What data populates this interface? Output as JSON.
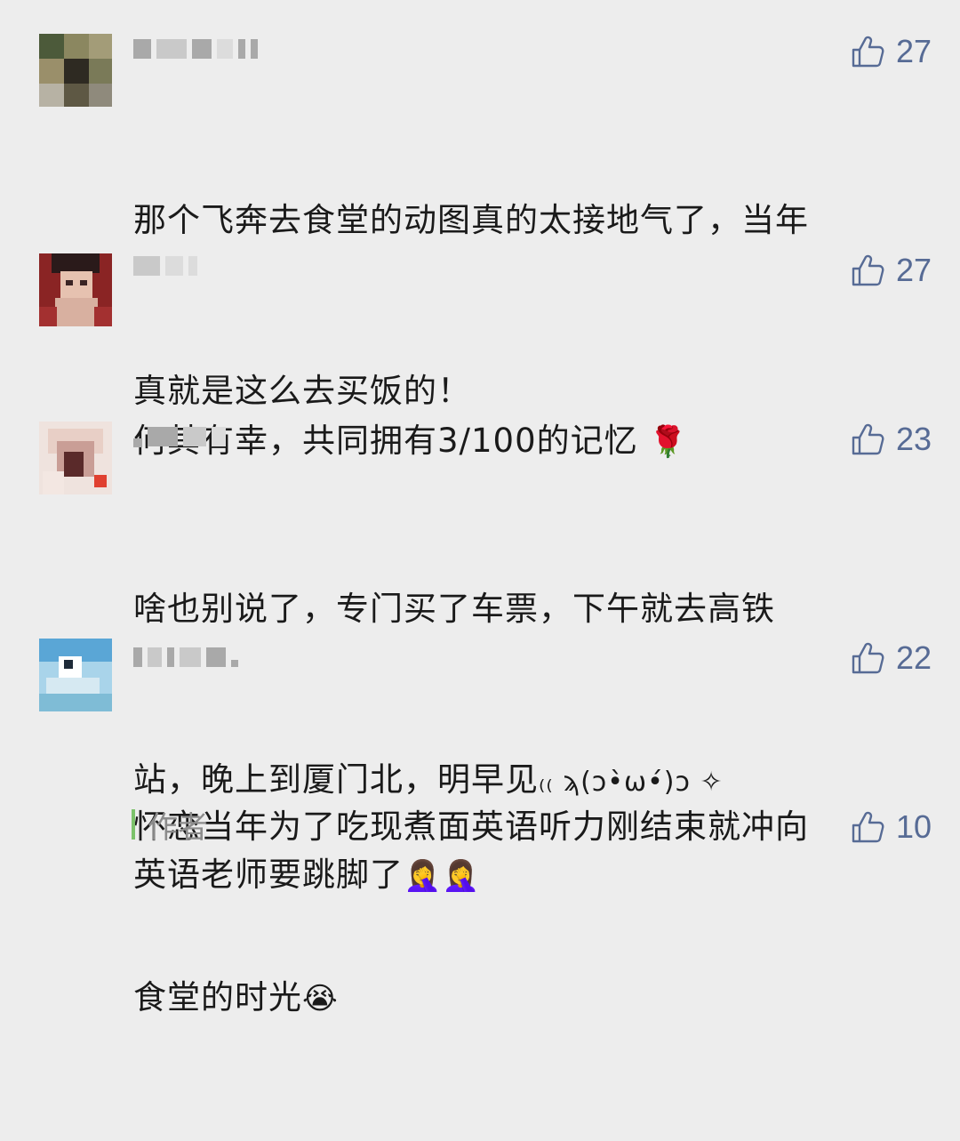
{
  "colors": {
    "background": "#ededed",
    "like_blue": "#576b95",
    "author_green": "#7cc26b"
  },
  "comments": [
    {
      "like_count": "27",
      "text_line1": "那个飞奔去食堂的动图真的太接地气了，当年",
      "text_line2": "真就是这么去买饭的！",
      "icon": "thumbs-up-icon"
    },
    {
      "like_count": "27",
      "text_line1": "何其有幸，共同拥有3/100的记忆",
      "emoji": "🌹",
      "icon": "thumbs-up-icon"
    },
    {
      "like_count": "23",
      "text_line1": "啥也别说了，专门买了车票，下午就去高铁",
      "text_line2": "站，晚上到厦门北，明早见",
      "kaomoji": "₍₍ ϡ(ↄ•̀ω•́)ↄ ✧",
      "icon": "thumbs-up-icon"
    },
    {
      "like_count": "22",
      "text_line1": "怀恋当年为了吃现煮面英语听力刚结束就冲向",
      "text_line2": "食堂的时光",
      "emoji": "😭",
      "icon": "thumbs-up-icon"
    }
  ],
  "author_reply": {
    "label": "作者",
    "like_count": "10",
    "text": "英语老师要跳脚了",
    "emoji1": "🤦‍♀️",
    "emoji2": "🤦‍♀️",
    "icon": "thumbs-up-icon"
  }
}
